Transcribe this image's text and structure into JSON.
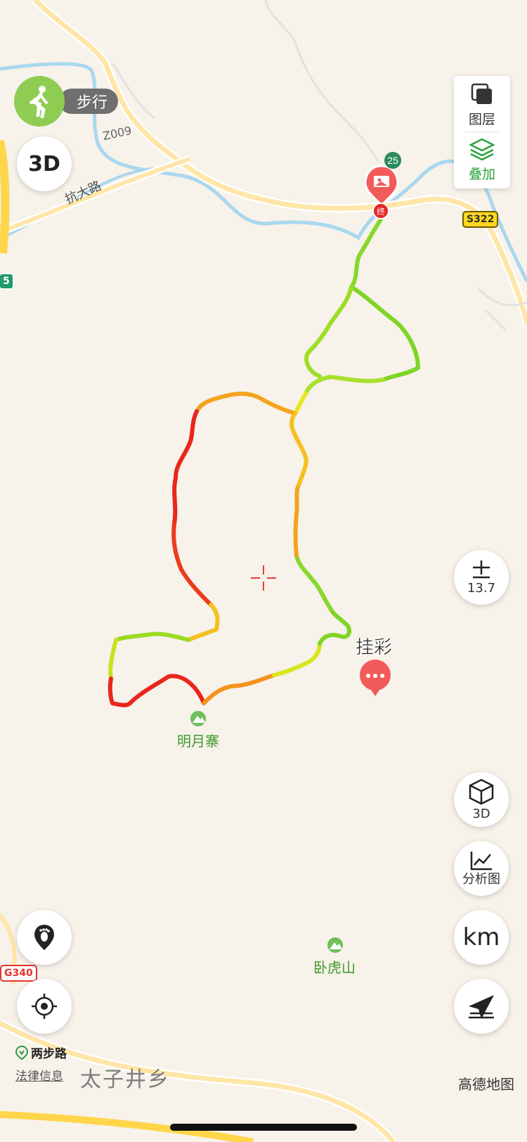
{
  "mode": {
    "label": "步行"
  },
  "buttons": {
    "three_d_top": "3D",
    "zoom_value": "13.7",
    "three_d_bottom": "3D",
    "analysis": "分析图",
    "units": "km"
  },
  "panel": {
    "layers": "图层",
    "overlay": "叠加"
  },
  "markers": {
    "end_badge": "25",
    "end_label": "终",
    "poi_name": "挂彩"
  },
  "places": {
    "mingyuezhai": "明月寨",
    "wohushan": "卧虎山",
    "taizijing": "太子井乡"
  },
  "roads": {
    "kangda": "抗大路",
    "z009": "Z009",
    "s322": "S322",
    "g340": "G340",
    "left_edge": "5"
  },
  "footer": {
    "partner": "两步路",
    "legal": "法律信息",
    "brand": "高德地图"
  },
  "colors": {
    "route_low": "#6ecf1f",
    "route_mid": "#f2e21a",
    "route_high": "#e8231d",
    "water": "#a9d7ef",
    "road": "#ffe6a8",
    "accent_green": "#29a33a",
    "marker_red": "#f35a5a"
  },
  "icons": [
    "walk-icon",
    "3d-text-icon",
    "layers-icon",
    "overlay-icon",
    "zoom-icon",
    "cube-icon",
    "chart-icon",
    "footprint-icon",
    "locate-icon",
    "share-icon",
    "photo-icon",
    "chat-icon",
    "peak-icon",
    "crosshair-icon"
  ]
}
